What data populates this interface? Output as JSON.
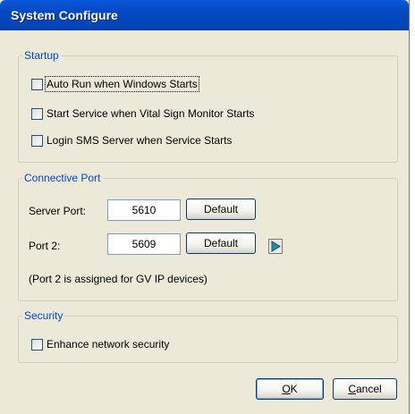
{
  "window": {
    "title": "System Configure"
  },
  "startup": {
    "legend": "Startup",
    "options": [
      {
        "label": "Auto Run when Windows Starts",
        "checked": false
      },
      {
        "label": "Start Service when Vital Sign Monitor Starts",
        "checked": false
      },
      {
        "label": "Login SMS Server when Service Starts",
        "checked": false
      }
    ]
  },
  "connective_port": {
    "legend": "Connective Port",
    "server_port": {
      "label": "Server Port:",
      "value": "5610",
      "default_label": "Default"
    },
    "port2": {
      "label": "Port 2:",
      "value": "5609",
      "default_label": "Default"
    },
    "note": "(Port 2 is assigned for GV IP devices)",
    "arrow_icon": "play-arrow-icon"
  },
  "security": {
    "legend": "Security",
    "option": {
      "label": "Enhance network security",
      "checked": false
    }
  },
  "buttons": {
    "ok_accel": "O",
    "ok_rest": "K",
    "cancel_accel": "C",
    "cancel_rest": "ancel"
  }
}
